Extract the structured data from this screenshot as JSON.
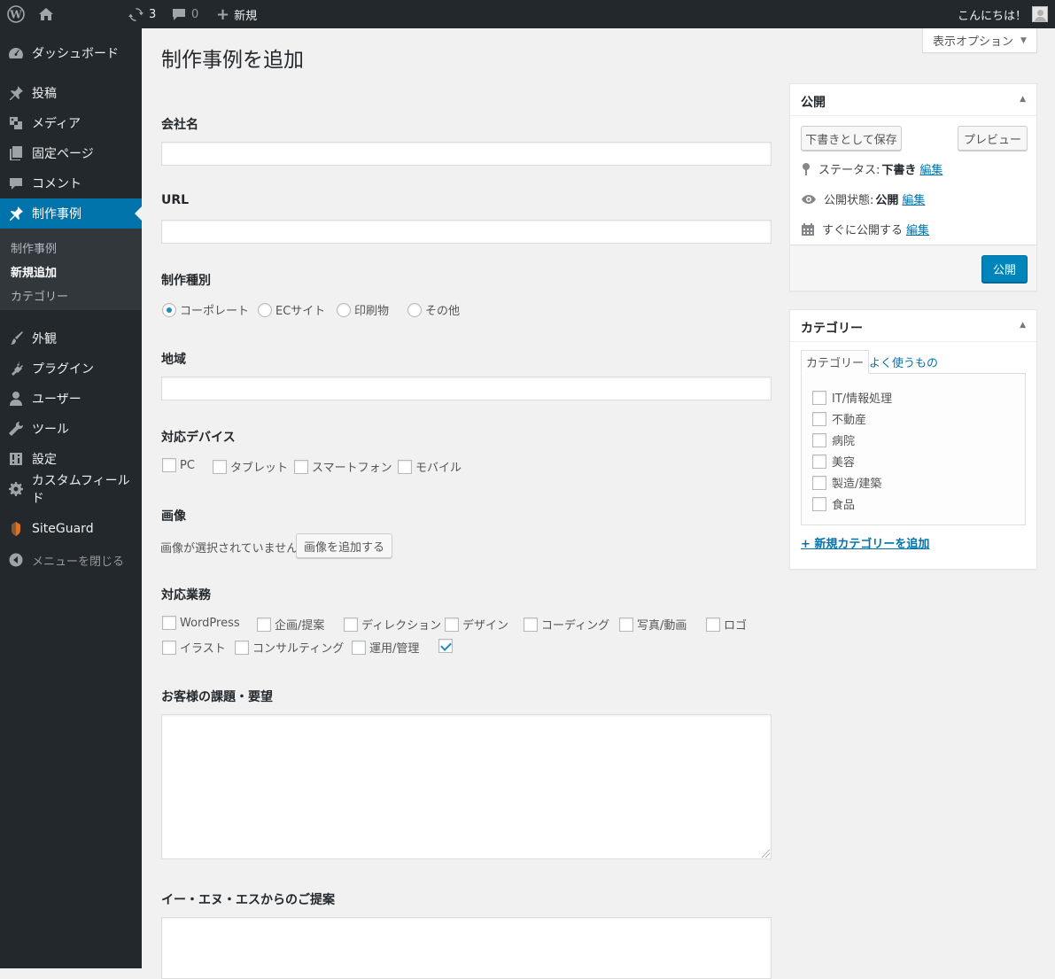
{
  "adminbar": {
    "updates_count": "3",
    "comments_count": "0",
    "new_label": "新規",
    "greeting": "こんにちは！"
  },
  "menu": {
    "items": [
      {
        "label": "ダッシュボード",
        "icon": "dashboard-icon"
      },
      {
        "label": "投稿",
        "icon": "pin-icon"
      },
      {
        "label": "メディア",
        "icon": "media-icon"
      },
      {
        "label": "固定ページ",
        "icon": "pages-icon"
      },
      {
        "label": "コメント",
        "icon": "comment-icon"
      },
      {
        "label": "制作事例",
        "icon": "pin-icon"
      },
      {
        "label": "外観",
        "icon": "brush-icon"
      },
      {
        "label": "プラグイン",
        "icon": "plugin-icon"
      },
      {
        "label": "ユーザー",
        "icon": "user-icon"
      },
      {
        "label": "ツール",
        "icon": "wrench-icon"
      },
      {
        "label": "設定",
        "icon": "settings-icon"
      },
      {
        "label": "カスタムフィールド",
        "icon": "gear-icon"
      },
      {
        "label": "SiteGuard",
        "icon": "siteguard-icon"
      },
      {
        "label": "メニューを閉じる",
        "icon": "collapse-icon"
      }
    ],
    "submenu": [
      "制作事例",
      "新規追加",
      "カテゴリー"
    ]
  },
  "page": {
    "title": "制作事例を追加",
    "screen_options": "表示オプション"
  },
  "form": {
    "company_label": "会社名",
    "url_label": "URL",
    "type_label": "制作種別",
    "type_options": [
      "コーポレート",
      "ECサイト",
      "印刷物",
      "その他"
    ],
    "type_selected": "コーポレート",
    "region_label": "地域",
    "devices_label": "対応デバイス",
    "devices": [
      "PC",
      "タブレット",
      "スマートフォン",
      "モバイル"
    ],
    "image_label": "画像",
    "image_none": "画像が選択されていません",
    "image_button": "画像を追加する",
    "services_label": "対応業務",
    "services_row1": [
      "WordPress",
      "企画/提案",
      "ディレクション",
      "デザイン",
      "コーディング",
      "写真/動画",
      "ロゴ"
    ],
    "services_row2": [
      "イラスト",
      "コンサルティング",
      "運用/管理",
      ""
    ],
    "issues_label": "お客様の課題・要望",
    "proposal_label": "イー・エヌ・エスからのご提案"
  },
  "publish": {
    "title": "公開",
    "save_draft": "下書きとして保存",
    "preview": "プレビュー",
    "status_label": "ステータス:",
    "status_value": "下書き",
    "visibility_label": "公開状態:",
    "visibility_value": "公開",
    "schedule_label": "すぐに公開する",
    "edit_link": "編集",
    "publish_button": "公開"
  },
  "category": {
    "title": "カテゴリー",
    "tab_all": "カテゴリー",
    "tab_popular": "よく使うもの",
    "items": [
      "IT/情報処理",
      "不動産",
      "病院",
      "美容",
      "製造/建築",
      "食品"
    ],
    "add_new": "+ 新規カテゴリーを追加"
  },
  "colors": {
    "adminbar": "#23282d",
    "menu_active": "#0073aa",
    "primary_button": "#0085ba",
    "link": "#0073aa"
  }
}
